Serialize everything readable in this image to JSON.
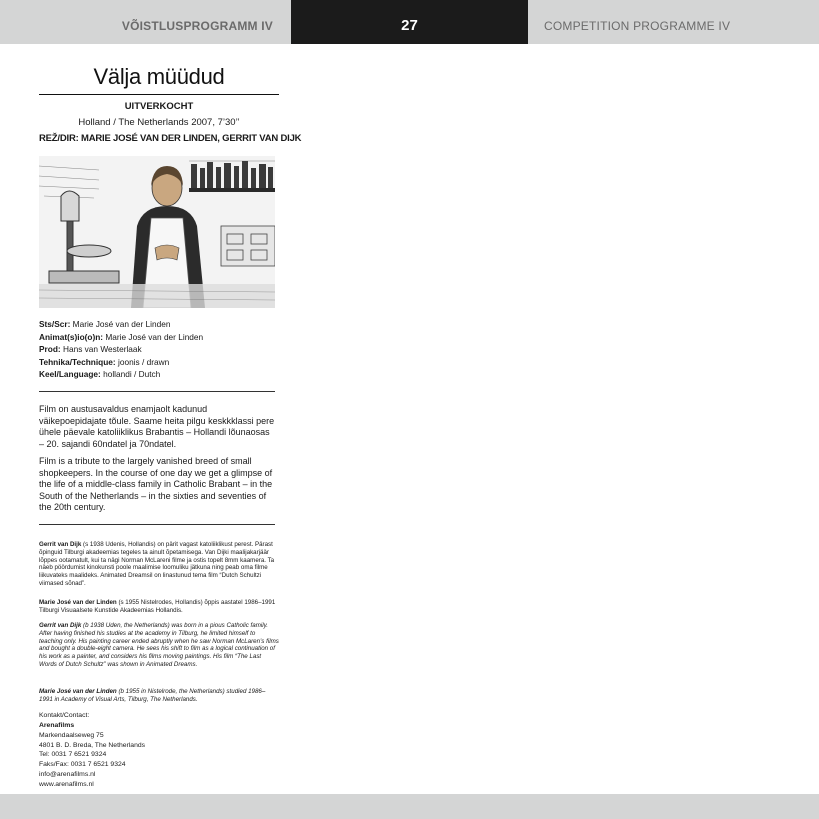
{
  "header": {
    "left": "VÕISTLUSPROGRAMM IV",
    "page_number": "27",
    "right": "COMPETITION PROGRAMME IV"
  },
  "film": {
    "title": "Välja müüdud",
    "original_title": "UITVERKOCHT",
    "country_year_length": "Holland / The Netherlands 2007, 7’30’’",
    "director": "REŽ/DIR: MARIE JOSÉ VAN DER LINDEN, GERRIT VAN DIJK"
  },
  "credits": [
    {
      "label": "Sts/Scr:",
      "value": "Marie José van der Linden"
    },
    {
      "label": "Animat(s)io(o)n:",
      "value": "Marie José van der Linden"
    },
    {
      "label": "Prod:",
      "value": "Hans van Westerlaak"
    },
    {
      "label": "Tehnika/Technique:",
      "value": "joonis / drawn"
    },
    {
      "label": "Keel/Language:",
      "value": "hollandi / Dutch"
    }
  ],
  "synopsis": {
    "et": "Film on austusavaldus enamjaolt kadunud väikepoepidajate tõule. Saame heita pilgu keskkklassi pere ühele päevale katoliiklikus Brabantis – Hollandi lõunaosas – 20. sajandi 60ndatel ja 70ndatel.",
    "en": "Film is a tribute to the largely vanished breed of small shopkeepers. In the course of one day we get a glimpse of the life of a middle-class family in Catholic Brabant – in the South of the Netherlands – in the sixties and seventies of the 20th century."
  },
  "bios": {
    "et1_name": "Gerrit van Dijk",
    "et1_text": " (s 1938 Udenis, Hollandis) on pärit vagast katoliiklikust perest. Pärast õpinguid Tilburgi akadeemias tegeles ta ainult õpetamisega. Van Dijki maalijakarjäär lõppes ootamatult, kui ta nägi Norman McLareni filme ja ostis topelt 8mm kaamera. Ta näeb pöördumist kinokunsti poole maalimise loomuliku jätkuna ning peab oma filme liikuvateks maalideks. Animated Dreamsil on linastunud tema film “Dutch Schultzi viimased sõnad”.",
    "et2_name": "Marie José van der Linden",
    "et2_text": " (s 1955 Nistelrodes, Hollandis) õppis aastatel 1986–1991 Tilburgi Visuaalsete Kunstide Akadeemias Hollandis.",
    "en1_name": "Gerrit van Dijk",
    "en1_text": " (b 1938 Uden, the Netherlands) was born in a pious Catholic family. After having finished his studies at the academy in Tilburg, he limited himself to teaching only. His painting career ended abruptly when he saw Norman McLaren’s films and bought a double-eight camera. He sees his shift to film as a logical continuation of his work as a painter, and considers his films moving paintings. His film “The Last Words of Dutch Schultz” was shown in Animated Dreams.",
    "en2_name": "Marie José van der Linden",
    "en2_text": " (b 1955 in Nistelrode, the Netherlands) studied 1986–1991 in Academy of Visual Arts, Tilburg, The Netherlands."
  },
  "contact": {
    "heading": "Kontakt/Contact:",
    "company": "Arenafilms",
    "address1": "Markendaalseweg 75",
    "address2": "4801 B. D. Breda, The Netherlands",
    "tel": "Tel: 0031 7 6521 9324",
    "fax": "Faks/Fax: 0031 7 6521 9324",
    "email": "info@arenafilms.nl",
    "web": "www.arenafilms.nl"
  }
}
